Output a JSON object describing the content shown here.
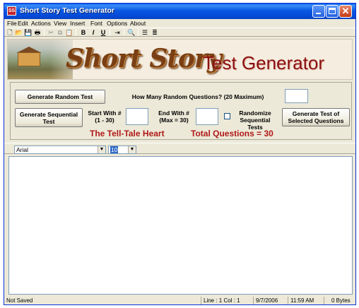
{
  "window": {
    "title": "Short Story Test Generator",
    "app_icon": "SS"
  },
  "menu": [
    "File",
    "Edit",
    "Actions",
    "View",
    "Insert",
    "Font",
    "Options",
    "About"
  ],
  "toolbar_icons": [
    "new-icon",
    "open-icon",
    "save-icon",
    "print-icon",
    "cut-icon",
    "copy-icon",
    "paste-icon",
    "bold-icon",
    "italic-icon",
    "underline-icon",
    "insert-icon",
    "find-icon",
    "align-left-icon",
    "bullets-icon"
  ],
  "banner": {
    "short_story": "Short Story",
    "test_generator": "Test Generator"
  },
  "controls": {
    "generate_random": "Generate Random Test",
    "how_many_label": "How Many Random Questions? (20 Maximum)",
    "generate_sequential": "Generate Sequential Test",
    "start_with_label": "Start With # (1 - 30)",
    "end_with_label": "End With # (Max = 30)",
    "randomize_label": "Randomize Sequential Tests",
    "generate_selected": "Generate Test of Selected Questions",
    "story_name": "The Tell-Tale Heart",
    "total_questions": "Total Questions = 30"
  },
  "format": {
    "font": "Arial",
    "size": "10"
  },
  "status": {
    "save_state": "Not Saved",
    "position": "Line : 1   Col : 1",
    "date": "9/7/2006",
    "time": "11:59 AM",
    "size": "0 Bytes"
  },
  "colors": {
    "titlebar": "#0a58e3",
    "story_red": "#b01818",
    "logo_brown": "#7a3f14"
  }
}
